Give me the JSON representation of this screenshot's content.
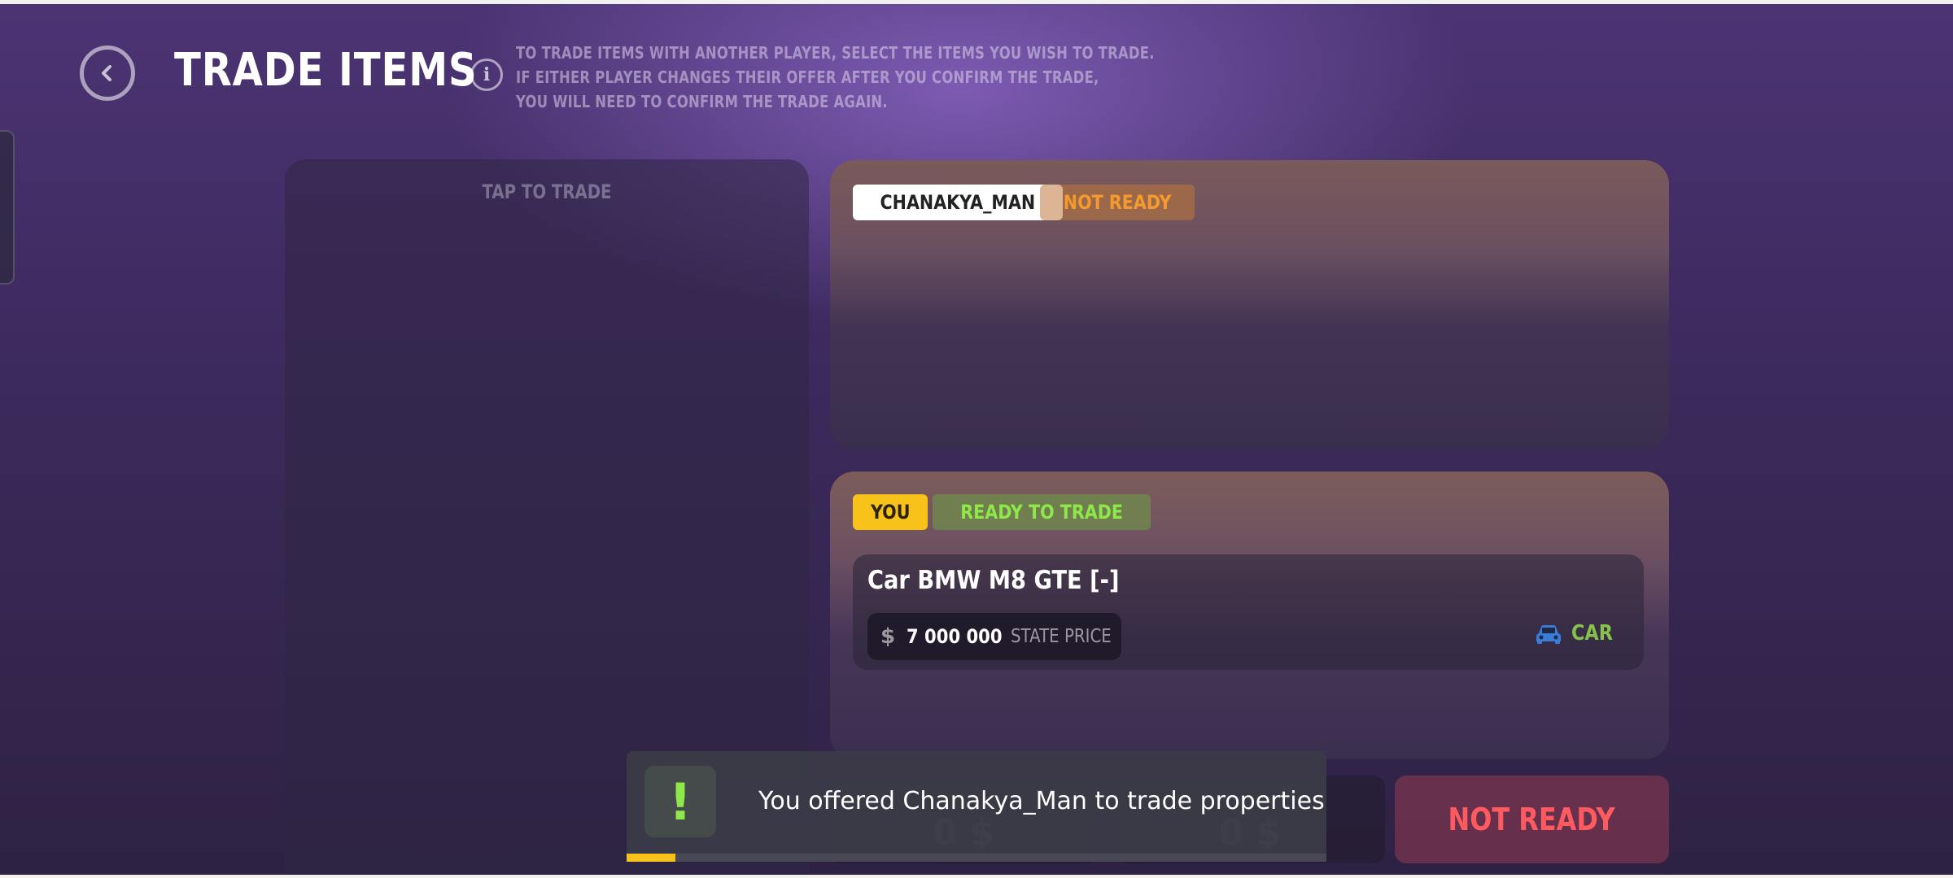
{
  "header": {
    "title": "TRADE ITEMS",
    "info_lines": [
      "TO TRADE ITEMS WITH ANOTHER PLAYER, SELECT THE ITEMS YOU WISH TO TRADE.",
      "IF EITHER PLAYER CHANGES THEIR OFFER AFTER YOU CONFIRM THE TRADE,",
      "YOU WILL NEED TO CONFIRM THE TRADE AGAIN."
    ]
  },
  "inventory": {
    "label": "TAP TO TRADE"
  },
  "other_player": {
    "name": "CHANAKYA_MAN",
    "status": "NOT READY"
  },
  "you": {
    "label": "YOU",
    "status": "READY TO TRADE",
    "items": [
      {
        "name": "Car BMW M8 GTE [-]",
        "currency": "$",
        "price": "7 000 000",
        "price_label": "STATE PRICE",
        "type": "CAR",
        "type_icon": "car-icon"
      }
    ]
  },
  "summary": {
    "other_total": "0 $",
    "your_total": "0 $"
  },
  "ready_button": {
    "label": "NOT READY"
  },
  "toast": {
    "icon": "!",
    "message": "You offered Chanakya_Man to trade properties",
    "progress": 0.07
  },
  "colors": {
    "not_ready": "#f59a2c",
    "ready": "#8ee84a",
    "you_badge": "#f7c21a",
    "not_ready_button": "#ff5a5f",
    "car_type": "#86c24a"
  }
}
